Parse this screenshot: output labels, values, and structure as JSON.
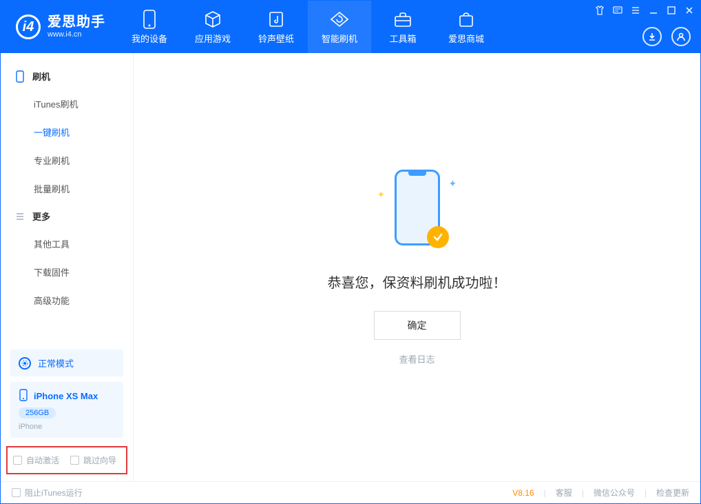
{
  "header": {
    "logo_title": "爱思助手",
    "logo_sub": "www.i4.cn",
    "tabs": [
      {
        "label": "我的设备",
        "icon": "device"
      },
      {
        "label": "应用游戏",
        "icon": "cube"
      },
      {
        "label": "铃声壁纸",
        "icon": "music"
      },
      {
        "label": "智能刷机",
        "icon": "refresh",
        "active": true
      },
      {
        "label": "工具箱",
        "icon": "toolbox"
      },
      {
        "label": "爱思商城",
        "icon": "bag"
      }
    ]
  },
  "sidebar": {
    "group1_label": "刷机",
    "group1_items": [
      {
        "label": "iTunes刷机"
      },
      {
        "label": "一键刷机",
        "active": true
      },
      {
        "label": "专业刷机"
      },
      {
        "label": "批量刷机"
      }
    ],
    "group2_label": "更多",
    "group2_items": [
      {
        "label": "其他工具"
      },
      {
        "label": "下载固件"
      },
      {
        "label": "高级功能"
      }
    ],
    "mode_label": "正常模式",
    "device_name": "iPhone XS Max",
    "device_storage": "256GB",
    "device_type": "iPhone",
    "checkbox1": "自动激活",
    "checkbox2": "跳过向导"
  },
  "main": {
    "success_title": "恭喜您，保资料刷机成功啦！",
    "ok_label": "确定",
    "log_link": "查看日志"
  },
  "footer": {
    "block_itunes": "阻止iTunes运行",
    "version": "V8.16",
    "link1": "客服",
    "link2": "微信公众号",
    "link3": "检查更新"
  }
}
